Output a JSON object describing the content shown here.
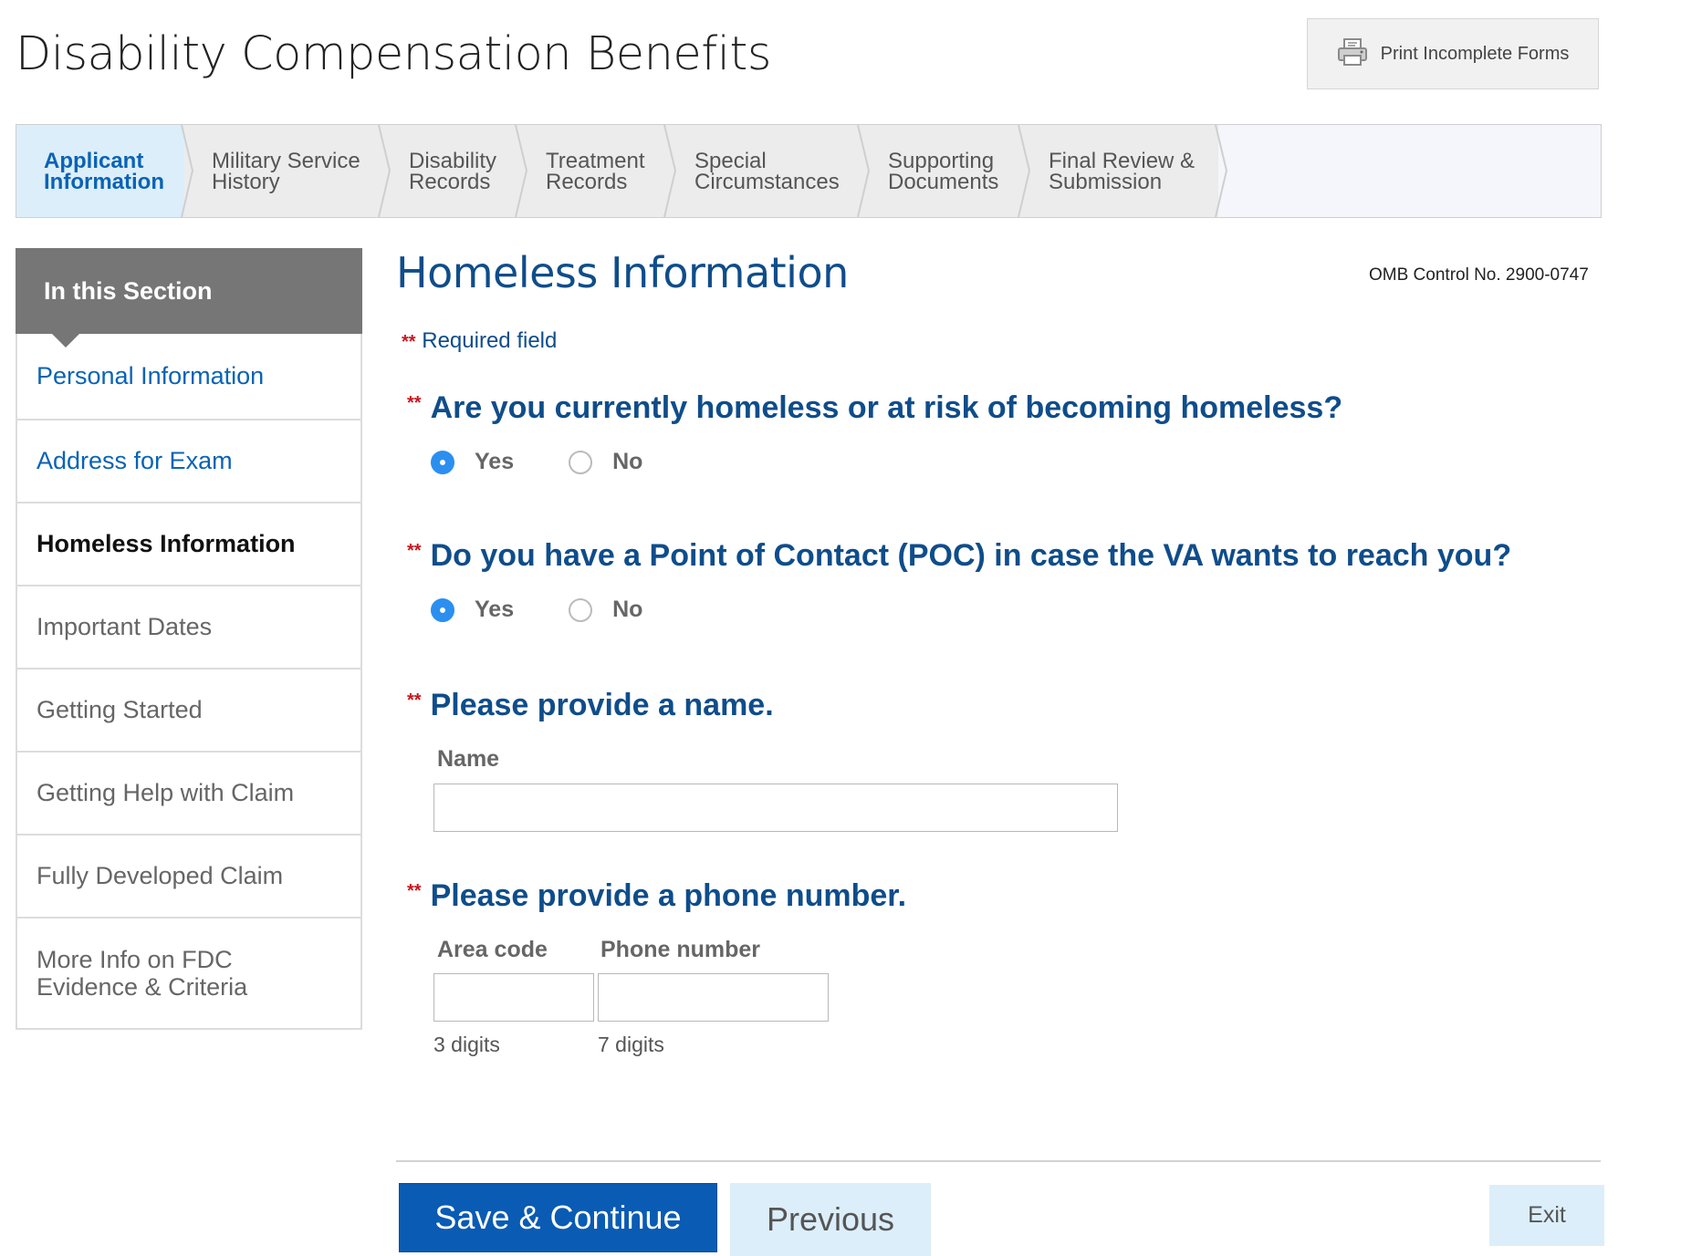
{
  "page": {
    "title": "Disability Compensation Benefits",
    "print_button": {
      "label": "Print Incomplete Forms",
      "icon": "printer-icon"
    }
  },
  "tabs": [
    {
      "label": "Applicant\nInformation",
      "active": true
    },
    {
      "label": "Military Service\nHistory",
      "active": false
    },
    {
      "label": "Disability\nRecords",
      "active": false
    },
    {
      "label": "Treatment\nRecords",
      "active": false
    },
    {
      "label": "Special\nCircumstances",
      "active": false
    },
    {
      "label": "Supporting\nDocuments",
      "active": false
    },
    {
      "label": "Final Review &\nSubmission",
      "active": false
    }
  ],
  "sidebar": {
    "heading": "In this Section",
    "items": [
      {
        "label": "Personal Information",
        "state": "link"
      },
      {
        "label": "Address for Exam",
        "state": "link"
      },
      {
        "label": "Homeless Information",
        "state": "current"
      },
      {
        "label": "Important Dates",
        "state": "disabled"
      },
      {
        "label": "Getting Started",
        "state": "disabled"
      },
      {
        "label": "Getting Help with Claim",
        "state": "disabled"
      },
      {
        "label": "Fully Developed Claim",
        "state": "disabled"
      },
      {
        "label": "More Info on FDC\nEvidence & Criteria",
        "state": "disabled"
      }
    ]
  },
  "section": {
    "title": "Homeless Information",
    "omb": "OMB Control No. 2900-0747",
    "required_marker": "**",
    "required_note": "Required field"
  },
  "questions": {
    "homeless": {
      "text": "Are you currently homeless or at risk of becoming homeless?",
      "yes_label": "Yes",
      "no_label": "No",
      "selected": "Yes"
    },
    "poc": {
      "text": "Do you have a Point of Contact (POC) in case the VA wants to reach you?",
      "yes_label": "Yes",
      "no_label": "No",
      "selected": "Yes"
    },
    "name": {
      "text": "Please provide a name.",
      "field_label": "Name",
      "value": ""
    },
    "phone": {
      "text": "Please provide a phone number.",
      "area_label": "Area code",
      "number_label": "Phone number",
      "area_value": "",
      "number_value": "",
      "area_hint": "3 digits",
      "number_hint": "7 digits"
    }
  },
  "footer": {
    "save_label": "Save & Continue",
    "previous_label": "Previous",
    "exit_label": "Exit"
  },
  "colors": {
    "brand_blue": "#0f4d8a",
    "link_blue": "#0a63b5",
    "required_red": "#c9141e",
    "radio_selected": "#2b8ff0",
    "active_tab_bg": "#dceefa"
  }
}
